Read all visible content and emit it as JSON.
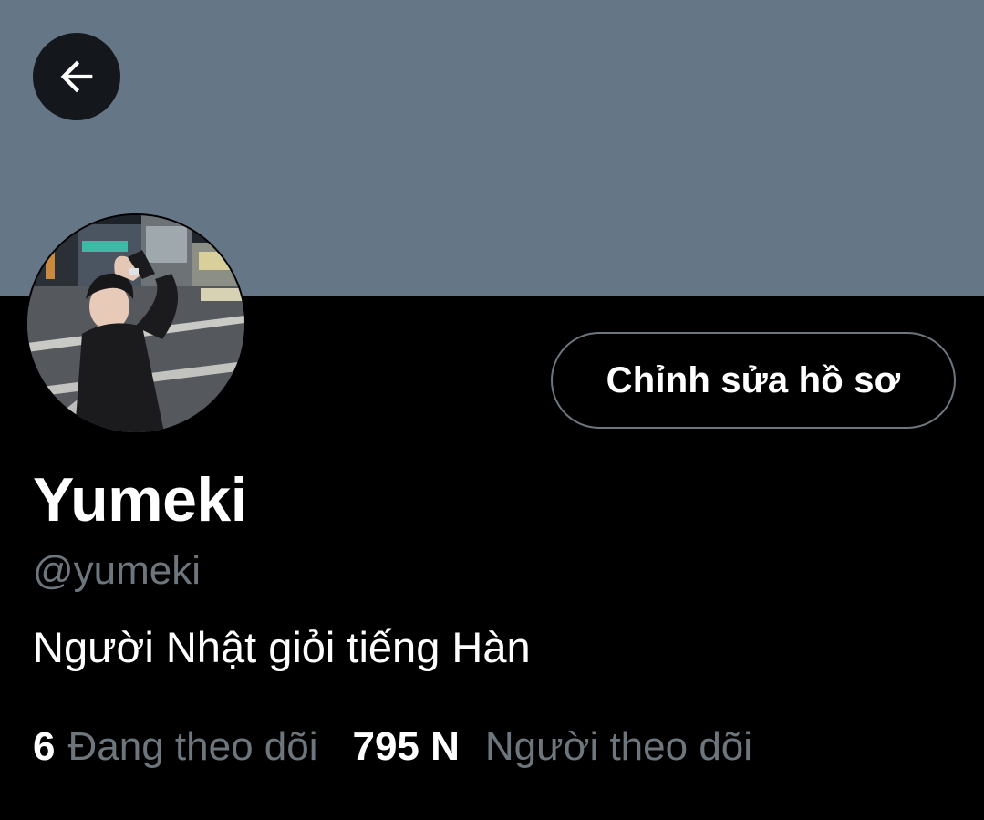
{
  "header": {
    "banner_color": "#657786",
    "back_button_icon": "arrow-left-icon"
  },
  "profile": {
    "avatar_icon": "profile-photo",
    "edit_button_label": "Chỉnh sửa hồ sơ",
    "display_name": "Yumeki",
    "handle": "@yumeki",
    "bio": "Người Nhật giỏi tiếng Hàn"
  },
  "stats": {
    "following_count": "6",
    "following_label": "Đang theo dõi",
    "followers_count": "795 N",
    "followers_label": "Người theo dõi"
  },
  "colors": {
    "background": "#000000",
    "primary_text": "#ffffff",
    "secondary_text": "#6e767d",
    "button_border": "#6e767d"
  }
}
